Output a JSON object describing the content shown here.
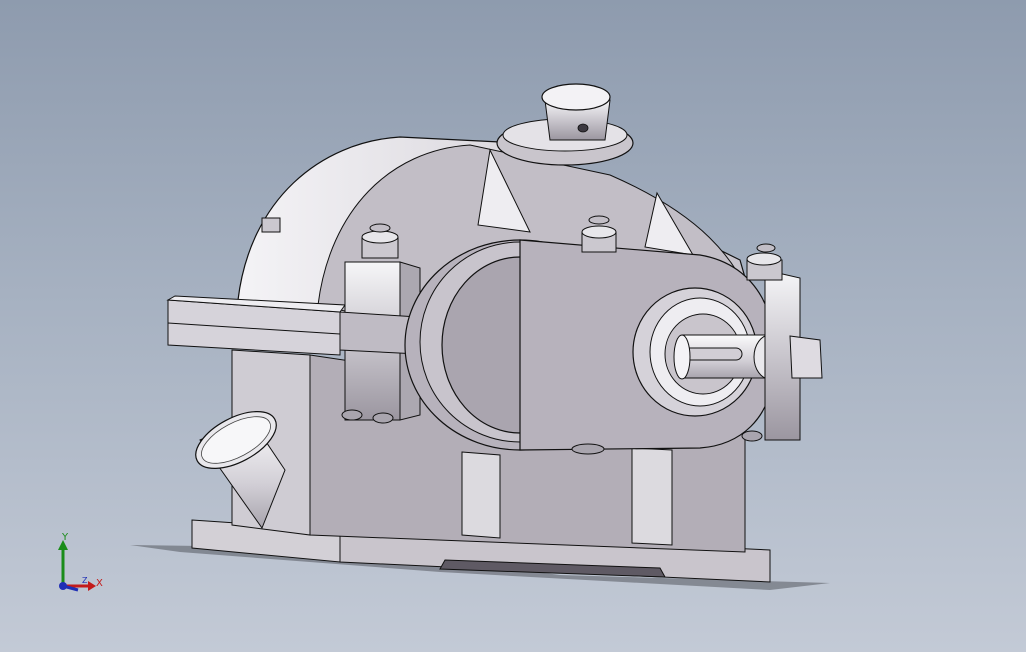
{
  "viewport": {
    "background_top": "#8e9bae",
    "background_bottom": "#c3cad6",
    "model_fill": "#c4c0c8",
    "model_shade": "#a39ea7",
    "model_light": "#f2f1f4",
    "edge_color": "#111111"
  },
  "triad": {
    "x_label": "X",
    "y_label": "Y",
    "z_label": "Z",
    "x_color": "#c31b1b",
    "y_color": "#1a8c1a",
    "z_color": "#1f2fb5"
  }
}
